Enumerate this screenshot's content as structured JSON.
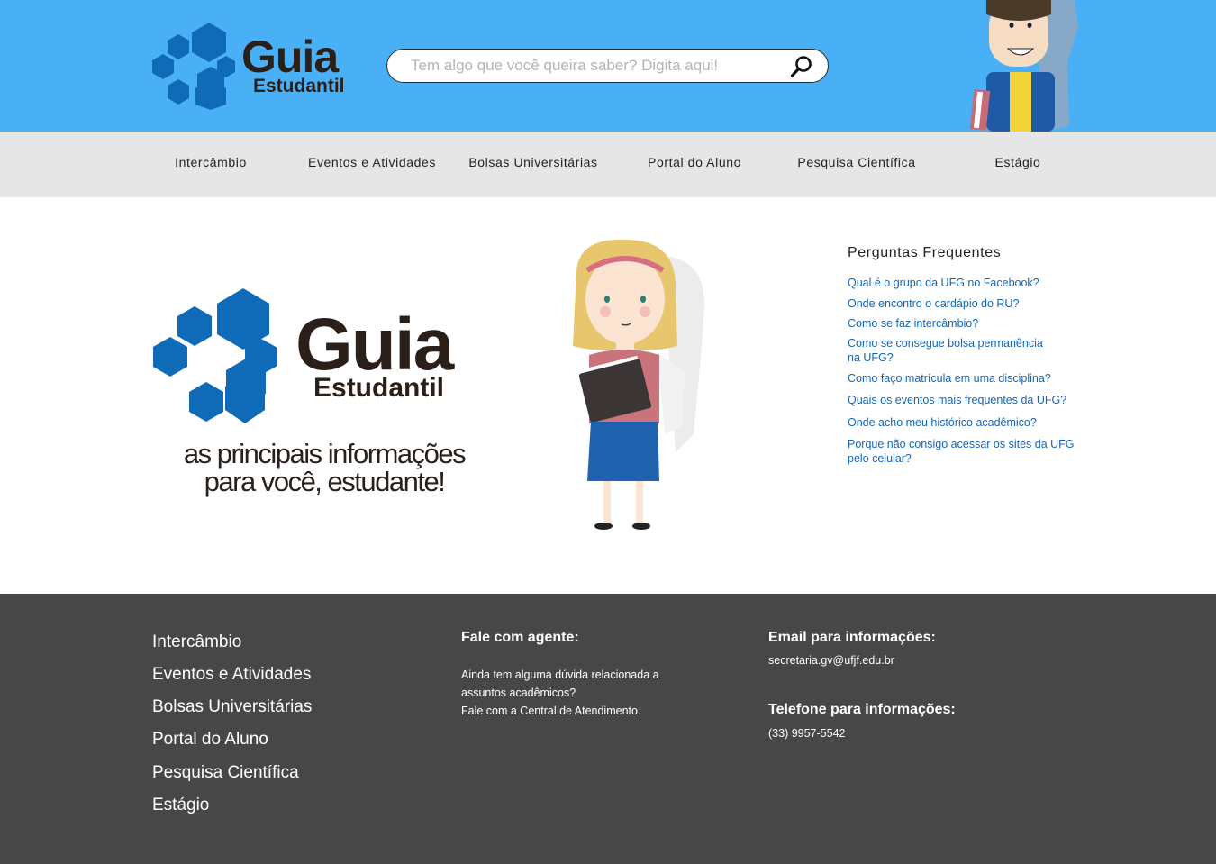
{
  "header": {
    "logo": {
      "title": "Guia",
      "subtitle": "Estudantil"
    },
    "search": {
      "placeholder": "Tem algo que você queira saber? Digita aqui!",
      "icon": "search-icon"
    }
  },
  "nav": {
    "items": [
      {
        "label": "Intercâmbio"
      },
      {
        "label": "Eventos e Atividades"
      },
      {
        "label": "Bolsas Universitárias"
      },
      {
        "label": "Portal do Aluno"
      },
      {
        "label": "Pesquisa Científica"
      },
      {
        "label": "Estágio"
      }
    ]
  },
  "hero": {
    "logo": {
      "title": "Guia",
      "subtitle": "Estudantil"
    },
    "tagline_line1": "as principais informações",
    "tagline_line2": "para você, estudante!"
  },
  "faq": {
    "title": "Perguntas Frequentes",
    "questions": [
      "Qual é o grupo da UFG no Facebook?",
      "Onde encontro o cardápio do RU?",
      "Como se faz intercâmbio?",
      "Como se consegue bolsa permanência na UFG?",
      "Como faço matrícula em uma disciplina?",
      "Quais os eventos mais frequentes da UFG?",
      "Onde acho meu histórico acadêmico?",
      "Porque não consigo acessar os sites da UFG pelo celular?"
    ]
  },
  "footer": {
    "links": [
      "Intercâmbio",
      "Eventos e Atividades",
      "Bolsas Universitárias",
      "Portal do Aluno",
      "Pesquisa Científica",
      "Estágio"
    ],
    "agent": {
      "heading": "Fale com agente:",
      "line1": "Ainda tem alguma dúvida relacionada a",
      "line2": "assuntos acadêmicos?",
      "line3": "Fale com a Central de Atendimento."
    },
    "email": {
      "heading": "Email para informações:",
      "value": "secretaria.gv@ufjf.edu.br"
    },
    "phone": {
      "heading": "Telefone para informações:",
      "value": "(33) 9957-5542"
    }
  },
  "colors": {
    "header_bg": "#4ab0f5",
    "nav_bg": "#e6e6e6",
    "logo_blue": "#0f6bb8",
    "link_blue": "#1565b4",
    "footer_bg": "#474747"
  }
}
